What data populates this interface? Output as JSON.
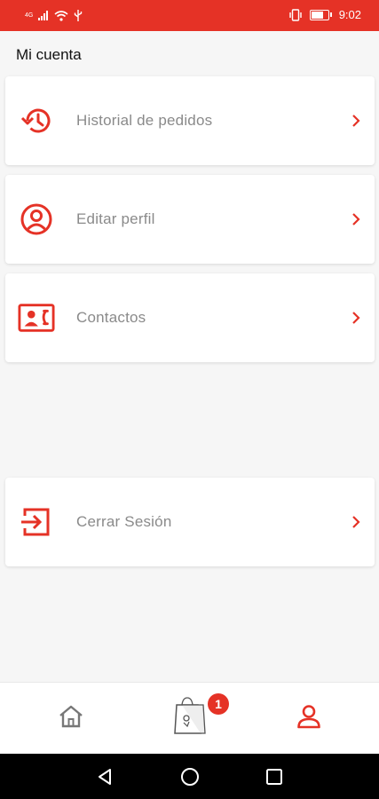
{
  "status_bar": {
    "time": "9:02",
    "network_label": "4G"
  },
  "page": {
    "title": "Mi cuenta"
  },
  "menu": [
    {
      "id": "order-history",
      "label": "Historial de pedidos",
      "icon": "history-icon"
    },
    {
      "id": "edit-profile",
      "label": "Editar perfil",
      "icon": "user-circle-icon"
    },
    {
      "id": "contacts",
      "label": "Contactos",
      "icon": "contact-card-icon"
    },
    {
      "id": "logout",
      "label": "Cerrar Sesión",
      "icon": "logout-icon"
    }
  ],
  "bottom_nav": {
    "items": [
      {
        "id": "home",
        "icon": "home-icon"
      },
      {
        "id": "cart",
        "icon": "shopping-bag-icon",
        "badge": "1"
      },
      {
        "id": "account",
        "icon": "user-icon",
        "active": true
      }
    ]
  },
  "colors": {
    "accent": "#e53226",
    "label_gray": "#8a8a8a",
    "background": "#f6f6f6"
  }
}
